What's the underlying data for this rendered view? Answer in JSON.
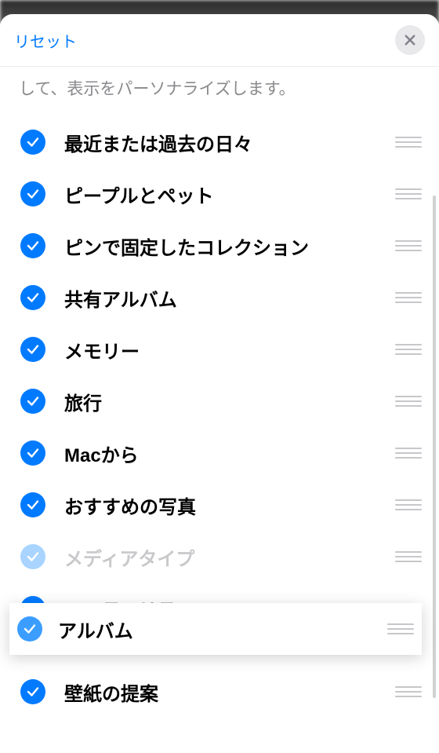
{
  "header": {
    "reset_label": "リセット"
  },
  "description": "して、表示をパーソナライズします。",
  "items": [
    {
      "label": "最近または過去の日々"
    },
    {
      "label": "ピープルとペット"
    },
    {
      "label": "ピンで固定したコレクション"
    },
    {
      "label": "共有アルバム"
    },
    {
      "label": "メモリー"
    },
    {
      "label": "旅行"
    },
    {
      "label": "Macから"
    },
    {
      "label": "おすすめの写真"
    },
    {
      "label": "メディアタイプ"
    },
    {
      "label": "ユーティリティ"
    },
    {
      "label": "壁紙の提案"
    }
  ],
  "dragging": {
    "label": "アルバム"
  }
}
